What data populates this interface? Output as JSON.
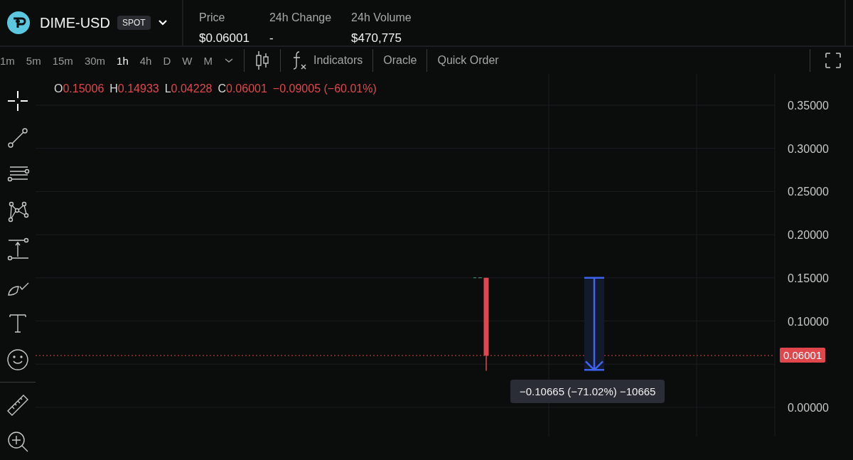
{
  "market": {
    "symbol": "DIME-USD",
    "badge": "SPOT"
  },
  "stats": [
    {
      "label": "Price",
      "value": "$0.06001"
    },
    {
      "label": "24h Change",
      "value": "-"
    },
    {
      "label": "24h Volume",
      "value": "$470,775"
    }
  ],
  "timeframes": [
    {
      "label": "1m",
      "selected": false
    },
    {
      "label": "5m",
      "selected": false
    },
    {
      "label": "15m",
      "selected": false
    },
    {
      "label": "30m",
      "selected": false
    },
    {
      "label": "1h",
      "selected": true
    },
    {
      "label": "4h",
      "selected": false
    },
    {
      "label": "D",
      "selected": false
    },
    {
      "label": "W",
      "selected": false
    },
    {
      "label": "M",
      "selected": false
    }
  ],
  "toolbar": {
    "indicators": "Indicators",
    "oracle": "Oracle",
    "quick_order": "Quick Order"
  },
  "tools": [
    {
      "kind": "crosshair",
      "selected": true
    },
    {
      "kind": "line",
      "selected": false
    },
    {
      "kind": "lines",
      "selected": false
    },
    {
      "kind": "pattern",
      "selected": false
    },
    {
      "kind": "measure",
      "selected": false
    },
    {
      "kind": "brush",
      "selected": false
    },
    {
      "kind": "text",
      "selected": false
    },
    {
      "kind": "emoji",
      "selected": false
    },
    {
      "kind": "divider",
      "selected": false
    },
    {
      "kind": "ruler",
      "selected": false
    },
    {
      "kind": "zoom",
      "selected": false
    }
  ],
  "legend": [
    {
      "key": "O",
      "value": "0.15006"
    },
    {
      "key": "H",
      "value": "0.14933"
    },
    {
      "key": "L",
      "value": "0.04228"
    },
    {
      "key": "C",
      "value": "0.06001"
    },
    {
      "value": "−0.09005 (−60.01%)"
    }
  ],
  "price_axis": [
    "0.35000",
    "0.30000",
    "0.25000",
    "0.20000",
    "0.15000",
    "0.10000",
    "0.00000"
  ],
  "last_price": "0.06001",
  "measure": {
    "label": "−0.10665 (−71.02%) −10665"
  }
}
